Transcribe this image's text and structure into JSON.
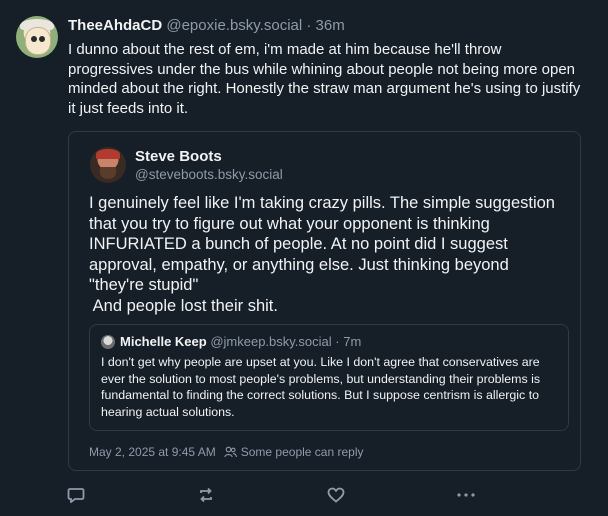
{
  "post": {
    "author": {
      "display_name": "TheeAhdaCD",
      "handle": "@epoxie.bsky.social"
    },
    "separator": " · ",
    "time_ago": "36m",
    "text": "I dunno about the rest of em, i'm made at him because he'll throw progressives under the bus while whining about people not being more open minded about the right. Honestly the straw man argument he's using to justify it just feeds into it."
  },
  "quote": {
    "author": {
      "display_name": "Steve Boots",
      "handle": "@steveboots.bsky.social"
    },
    "text_lines": [
      "I genuinely feel like I'm taking crazy pills. The simple suggestion",
      "that you try to figure out what your opponent is thinking",
      "INFURIATED a bunch of people. At no point did I suggest",
      "approval, empathy, or anything else. Just thinking beyond",
      "\"they're stupid\"",
      " And people lost their shit."
    ],
    "nested": {
      "author": {
        "display_name": "Michelle Keep",
        "handle": "@jmkeep.bsky.social"
      },
      "separator": " · ",
      "time_ago": "7m",
      "text": "I don't get why people are upset at you. Like I don't agree that conservatives are ever the solution to most people's problems, but understanding their problems is fundamental to finding the correct solutions. But I suppose centrism is allergic to hearing actual solutions."
    },
    "timestamp": "May 2, 2025 at 9:45 AM",
    "reply_setting": "Some people can reply"
  },
  "colors": {
    "background": "#161e27",
    "text": "#f1f3f5",
    "muted": "#8e9bab",
    "border": "#2e3a47"
  },
  "icons": [
    "reply-icon",
    "repost-icon",
    "like-icon",
    "more-icon",
    "people-icon"
  ]
}
